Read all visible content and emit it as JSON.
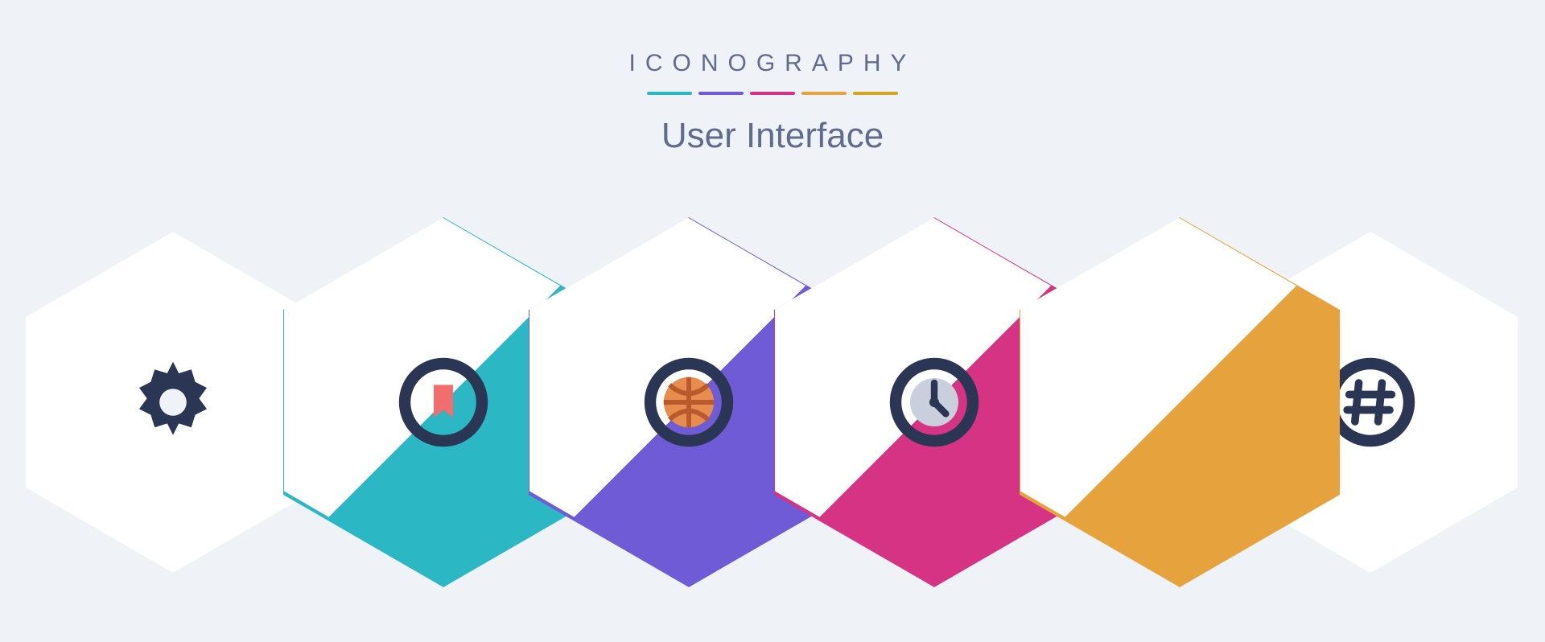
{
  "header": {
    "brand": "ICONOGRAPHY",
    "title": "User Interface"
  },
  "palette": {
    "teal": "#2bb7c4",
    "violet": "#6f5bd6",
    "magenta": "#d63384",
    "amber": "#e6a23c",
    "gold": "#d6a520",
    "navy": "#2b3554",
    "coral": "#f26d6d"
  },
  "icons": [
    {
      "name": "gear-icon",
      "rim": "teal"
    },
    {
      "name": "bookmark-icon",
      "rim": "violet"
    },
    {
      "name": "ball-icon",
      "rim": "magenta"
    },
    {
      "name": "clock-icon",
      "rim": "amber"
    },
    {
      "name": "hashtag-icon",
      "rim": "gold"
    }
  ]
}
